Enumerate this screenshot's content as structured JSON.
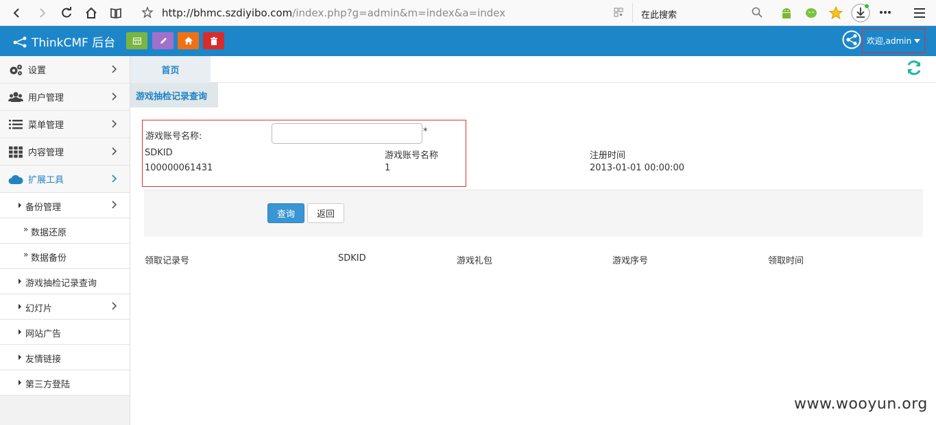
{
  "browser": {
    "url_host": "http://bhmc.szdiyibo.com",
    "url_path": "/index.php?g=admin&m=index&a=index",
    "search_placeholder": "在此搜索"
  },
  "header": {
    "brand": "ThinkCMF 后台",
    "welcome": "欢迎,admin",
    "accent": "#1d86c8"
  },
  "sidebar": {
    "items": [
      {
        "label": "设置"
      },
      {
        "label": "用户管理"
      },
      {
        "label": "菜单管理"
      },
      {
        "label": "内容管理"
      },
      {
        "label": "扩展工具"
      }
    ],
    "sub_items": [
      {
        "label": "备份管理"
      },
      {
        "label": "数据还原"
      },
      {
        "label": "数据备份"
      },
      {
        "label": "游戏抽检记录查询"
      },
      {
        "label": "幻灯片"
      },
      {
        "label": "网站广告"
      },
      {
        "label": "友情链接"
      },
      {
        "label": "第三方登陆"
      }
    ]
  },
  "tabs": {
    "home": "首页",
    "current": "游戏抽检记录查询"
  },
  "form": {
    "account_label": "游戏账号名称:",
    "required_mark": "*",
    "account_value": "",
    "info_headers": [
      "SDKID",
      "游戏账号名称",
      "注册时间"
    ],
    "info_values": [
      "100000061431",
      "1",
      "2013-01-01 00:00:00"
    ],
    "query_button": "查询",
    "back_button": "返回"
  },
  "table": {
    "columns": [
      "领取记录号",
      "SDKID",
      "游戏礼包",
      "游戏序号",
      "领取时间"
    ]
  },
  "watermark": "www.wooyun.org"
}
